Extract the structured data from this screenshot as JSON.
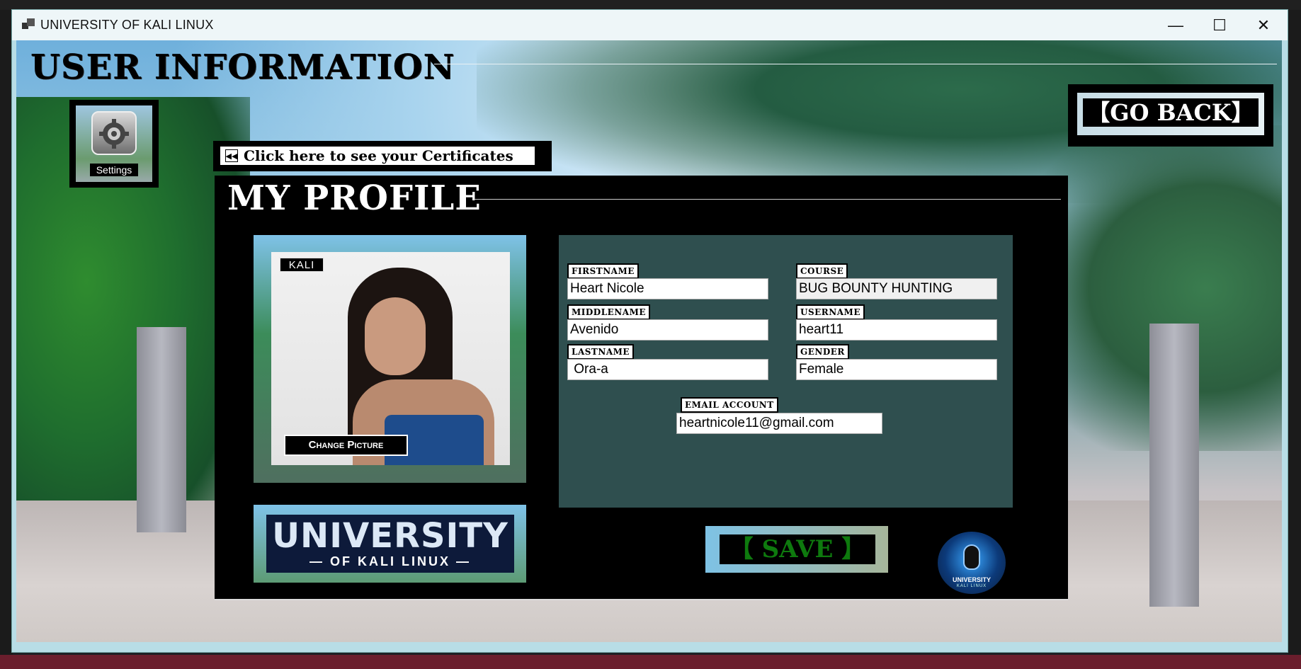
{
  "window": {
    "title": "UNIVERSITY OF KALI LINUX",
    "minimize_label": "—",
    "maximize_label": "☐",
    "close_label": "✕"
  },
  "page": {
    "heading": "USER INFORMATION",
    "settings_label": "Settings",
    "certificates_link": "Click here to see your Certificates",
    "go_back_label": "【GO BACK】"
  },
  "profile": {
    "title": "MY PROFILE",
    "photo_badge": "KALI",
    "change_picture_label": "Change Picture",
    "logo_main": "UNIVERSITY",
    "logo_sub": "— OF KALI LINUX —",
    "emblem_text": "UNIVERSITY",
    "emblem_sub": "KALI LINUX"
  },
  "form": {
    "firstname_label": "FIRSTNAME",
    "firstname_value": "Heart Nicole",
    "middlename_label": "MIDDLENAME",
    "middlename_value": "Avenido",
    "lastname_label": "LASTNAME",
    "lastname_value": " Ora-a",
    "course_label": "COURSE",
    "course_value": "BUG BOUNTY HUNTING",
    "username_label": "USERNAME",
    "username_value": "heart11",
    "gender_label": "GENDER",
    "gender_value": "Female",
    "email_label": "EMAIL ACCOUNT",
    "email_value": "heartnicole11@gmail.com",
    "save_label": "【 SAVE 】"
  },
  "colors": {
    "form_background": "#2f4f4f",
    "save_text": "#0e7a0e",
    "panel_background": "#000000"
  },
  "icons": {
    "app": "app-window-icon",
    "settings": "gear-icon",
    "certificates": "rewind-icon"
  }
}
